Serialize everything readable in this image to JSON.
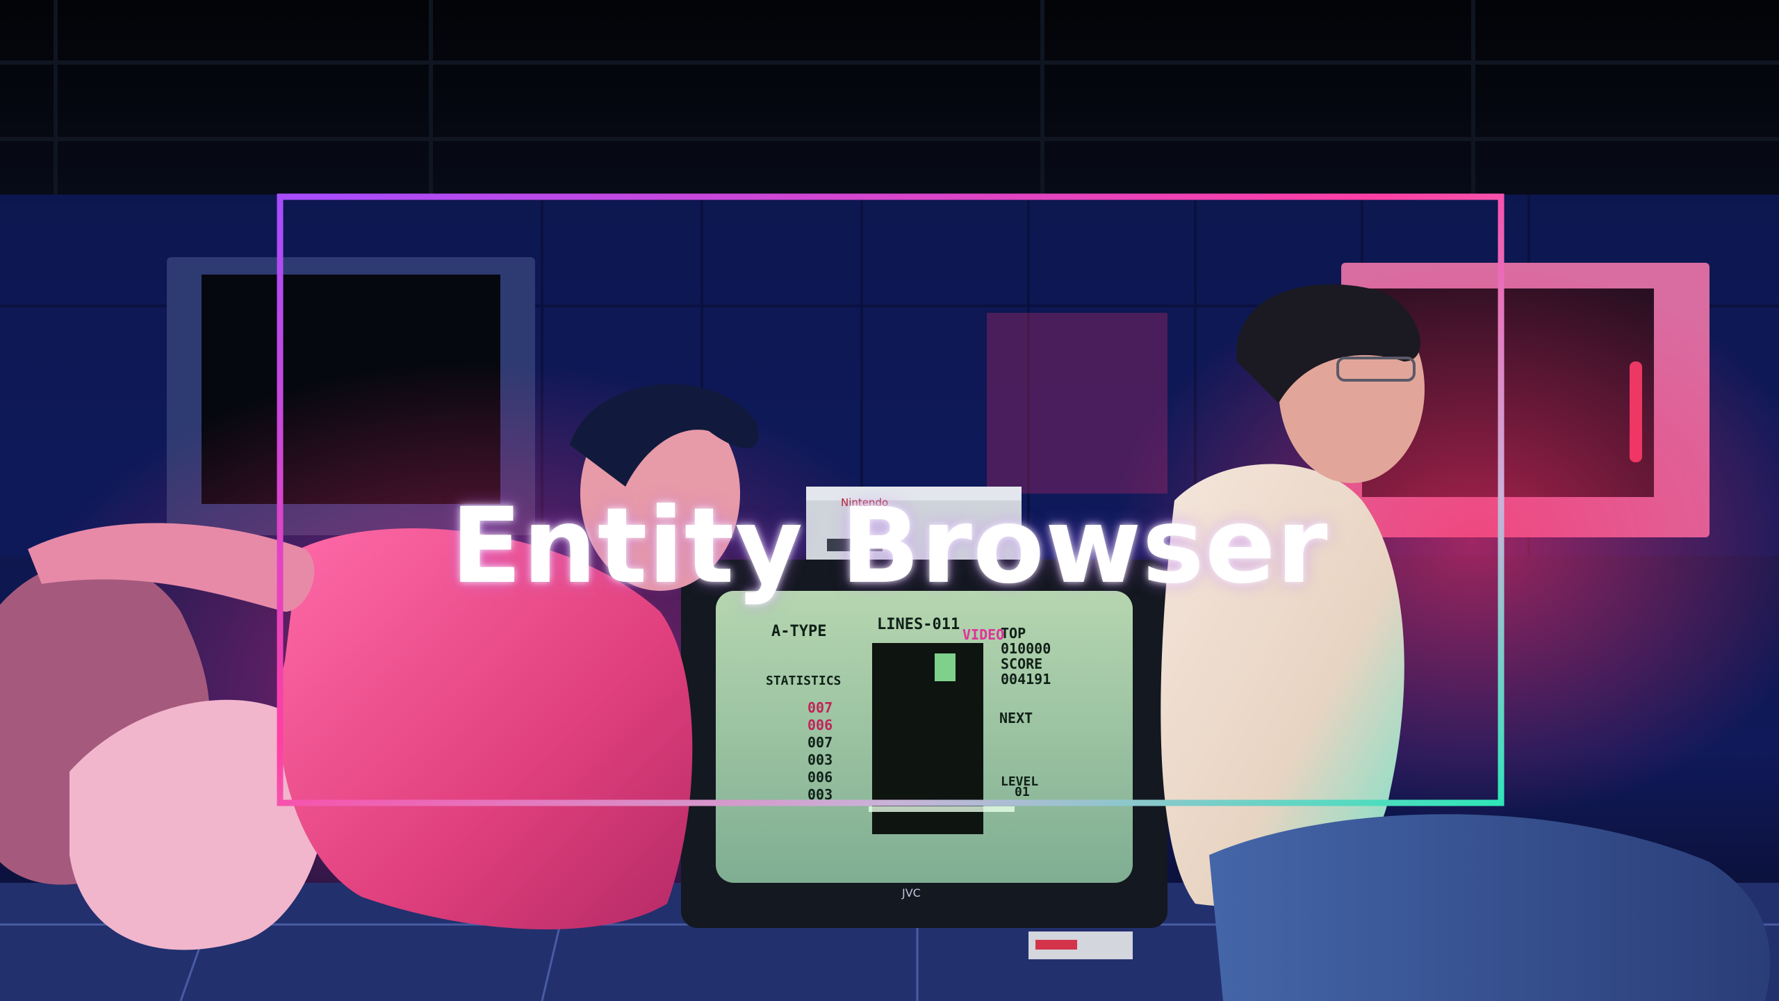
{
  "title": "Entity Browser",
  "screen": {
    "mode_label": "A-TYPE",
    "lines_label": "LINES-011",
    "overlay_label": "VIDEO",
    "top_label": "TOP",
    "top_value": "010000",
    "score_label": "SCORE",
    "score_value": "004191",
    "stats_label": "STATISTICS",
    "stats": [
      "007",
      "006",
      "007",
      "003",
      "006",
      "003"
    ],
    "next_label": "NEXT",
    "level_label": "LEVEL",
    "level_value": "01"
  },
  "tv_brand": "JVC",
  "console_brand": "Nintendo",
  "colors": {
    "frame_start": "#a64dff",
    "frame_mid": "#ff3fa4",
    "frame_end": "#2fe6b8",
    "neon_pink": "#ff2f7e",
    "neon_blue": "#2b3fb5"
  }
}
